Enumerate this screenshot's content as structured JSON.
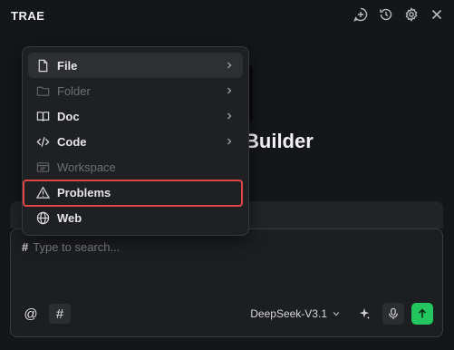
{
  "header": {
    "title": "TRAE",
    "icons": [
      "new-chat-icon",
      "history-icon",
      "settings-icon",
      "close-icon"
    ]
  },
  "main": {
    "welcome_title": "Builder"
  },
  "menu": {
    "items": [
      {
        "label": "File",
        "icon": "file-icon",
        "disabled": false,
        "has_submenu": true
      },
      {
        "label": "Folder",
        "icon": "folder-icon",
        "disabled": true,
        "has_submenu": true
      },
      {
        "label": "Doc",
        "icon": "book-icon",
        "disabled": false,
        "has_submenu": true
      },
      {
        "label": "Code",
        "icon": "code-icon",
        "disabled": false,
        "has_submenu": true
      },
      {
        "label": "Workspace",
        "icon": "workspace-icon",
        "disabled": true,
        "has_submenu": false
      },
      {
        "label": "Problems",
        "icon": "warning-icon",
        "disabled": false,
        "has_submenu": false
      },
      {
        "label": "Web",
        "icon": "globe-icon",
        "disabled": false,
        "has_submenu": false
      }
    ]
  },
  "chat": {
    "prefix": "#",
    "placeholder": "Type to search...",
    "mention_label": "@",
    "hash_label": "#",
    "model": "DeepSeek-V3.1"
  },
  "colors": {
    "accent_send": "#22c55e",
    "highlight": "#e04545"
  }
}
